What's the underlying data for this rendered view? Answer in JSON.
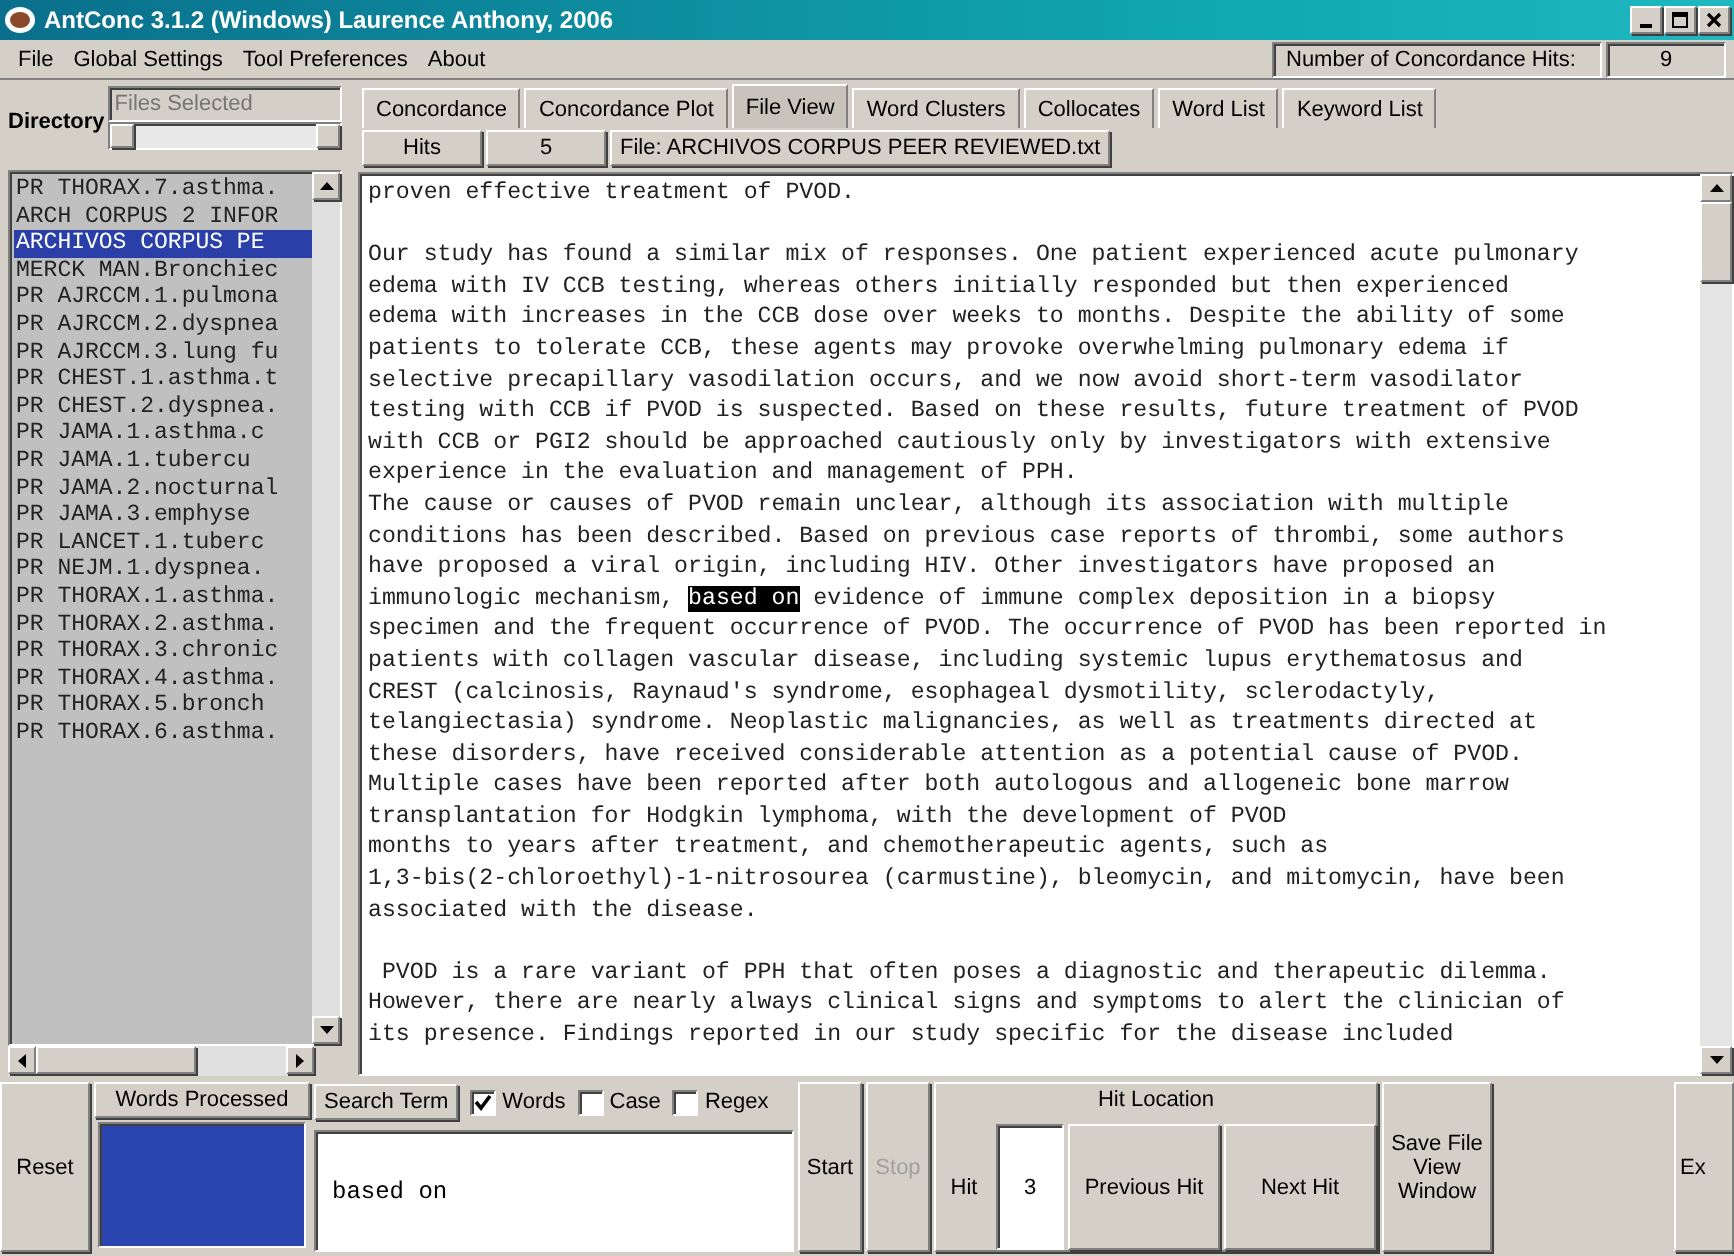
{
  "window": {
    "title": "AntConc 3.1.2 (Windows) Laurence Anthony, 2006"
  },
  "menu": [
    "File",
    "Global Settings",
    "Tool Preferences",
    "About"
  ],
  "concordance_hits": {
    "label": "Number of Concordance Hits:",
    "value": "9"
  },
  "directory": {
    "label": "Directory",
    "placeholder": "Files Selected"
  },
  "files": [
    {
      "name": "PR THORAX.7.asthma.",
      "selected": false
    },
    {
      "name": "ARCH CORPUS 2 INFOR",
      "selected": false
    },
    {
      "name": "ARCHIVOS CORPUS PE",
      "selected": true
    },
    {
      "name": "MERCK MAN.Bronchiec",
      "selected": false
    },
    {
      "name": "PR AJRCCM.1.pulmona",
      "selected": false
    },
    {
      "name": "PR AJRCCM.2.dyspnea",
      "selected": false
    },
    {
      "name": "PR AJRCCM.3.lung fu",
      "selected": false
    },
    {
      "name": "PR CHEST.1.asthma.t",
      "selected": false
    },
    {
      "name": "PR CHEST.2.dyspnea.",
      "selected": false
    },
    {
      "name": "PR JAMA.1.asthma.c",
      "selected": false
    },
    {
      "name": "PR JAMA.1.tubercu",
      "selected": false
    },
    {
      "name": "PR JAMA.2.nocturnal",
      "selected": false
    },
    {
      "name": "PR JAMA.3.emphyse",
      "selected": false
    },
    {
      "name": "PR LANCET.1.tuberc",
      "selected": false
    },
    {
      "name": "PR NEJM.1.dyspnea.",
      "selected": false
    },
    {
      "name": "PR THORAX.1.asthma.",
      "selected": false
    },
    {
      "name": "PR THORAX.2.asthma.",
      "selected": false
    },
    {
      "name": "PR THORAX.3.chronic",
      "selected": false
    },
    {
      "name": "PR THORAX.4.asthma.",
      "selected": false
    },
    {
      "name": "PR THORAX.5.bronch",
      "selected": false
    },
    {
      "name": "PR THORAX.6.asthma.",
      "selected": false
    }
  ],
  "tabs": [
    {
      "label": "Concordance",
      "selected": false
    },
    {
      "label": "Concordance Plot",
      "selected": false
    },
    {
      "label": "File View",
      "selected": true
    },
    {
      "label": "Word Clusters",
      "selected": false
    },
    {
      "label": "Collocates",
      "selected": false
    },
    {
      "label": "Word List",
      "selected": false
    },
    {
      "label": "Keyword List",
      "selected": false
    }
  ],
  "file_view": {
    "hits_label": "Hits",
    "hits": "5",
    "file": "File: ARCHIVOS CORPUS PEER REVIEWED.txt",
    "lines": [
      {
        "text": "proven effective treatment of PVOD.",
        "space_before": false
      },
      {
        "text": "Our study has found a similar mix of responses. One patient experienced acute pulmonary",
        "space_before": true
      },
      {
        "text": "edema with IV CCB testing, whereas others initially responded but then experienced",
        "space_before": false
      },
      {
        "text": "edema with increases in the CCB dose over weeks to months. Despite the ability of some",
        "space_before": false
      },
      {
        "text": "patients to tolerate CCB, these agents may provoke overwhelming pulmonary edema if",
        "space_before": false
      },
      {
        "text": "selective precapillary vasodilation occurs, and we now avoid short-term vasodilator",
        "space_before": false
      },
      {
        "text": "testing with CCB if PVOD is suspected. Based on these results, future treatment of PVOD",
        "space_before": false
      },
      {
        "text": "with CCB or PGI2 should be approached cautiously only by investigators with extensive",
        "space_before": false
      },
      {
        "text": "experience in the evaluation and management of PPH.",
        "space_before": false
      },
      {
        "text": "The cause or causes of PVOD remain unclear, although its association with multiple",
        "space_before": false
      },
      {
        "text": "conditions has been described. Based on previous case reports of thrombi, some authors",
        "space_before": false
      },
      {
        "text": "have proposed a viral origin, including HIV. Other investigators have proposed an",
        "space_before": false
      },
      {
        "text": "immunologic mechanism, ",
        "hit": "based on",
        "after": " evidence of immune complex deposition in a biopsy",
        "space_before": false
      },
      {
        "text": "specimen and the frequent occurrence of PVOD. The occurrence of PVOD has been reported in",
        "space_before": false
      },
      {
        "text": "patients with collagen vascular disease, including systemic lupus erythematosus and",
        "space_before": false
      },
      {
        "text": "CREST (calcinosis, Raynaud's syndrome, esophageal dysmotility, sclerodactyly,",
        "space_before": false
      },
      {
        "text": "telangiectasia) syndrome. Neoplastic malignancies, as well as treatments directed at",
        "space_before": false
      },
      {
        "text": "these disorders, have received considerable attention as a potential cause of PVOD.",
        "space_before": false
      },
      {
        "text": "Multiple cases have been reported after both autologous and allogeneic bone marrow",
        "space_before": false
      },
      {
        "text": "transplantation for Hodgkin lymphoma, with the development of PVOD",
        "space_before": false
      },
      {
        "text": "months to years after treatment, and chemotherapeutic agents, such as",
        "space_before": false
      },
      {
        "text": "1,3-bis(2-chloroethyl)-1-nitrosourea (carmustine), bleomycin, and mitomycin, have been",
        "space_before": false
      },
      {
        "text": "associated with the disease.",
        "space_before": false
      },
      {
        "text": " PVOD is a rare variant of PPH that often poses a diagnostic and therapeutic dilemma.",
        "space_before": true
      },
      {
        "text": "However, there are nearly always clinical signs and symptoms to alert the clinician of",
        "space_before": false
      },
      {
        "text": "its presence. Findings reported in our study specific for the disease included",
        "space_before": false
      }
    ]
  },
  "controls": {
    "reset": "Reset",
    "words_processed": "Words Processed",
    "search_term": "Search Term",
    "options": [
      {
        "label": "Words",
        "checked": true
      },
      {
        "label": "Case",
        "checked": false
      },
      {
        "label": "Regex",
        "checked": false
      }
    ],
    "search_value": "based on",
    "start": "Start",
    "stop": {
      "label": "Stop",
      "disabled": true
    },
    "hit_location": {
      "title": "Hit Location",
      "hit_label": "Hit",
      "hit": "3",
      "previous": "Previous Hit",
      "next": "Next Hit"
    },
    "save": "Save File View Window",
    "exit": "Ex"
  }
}
